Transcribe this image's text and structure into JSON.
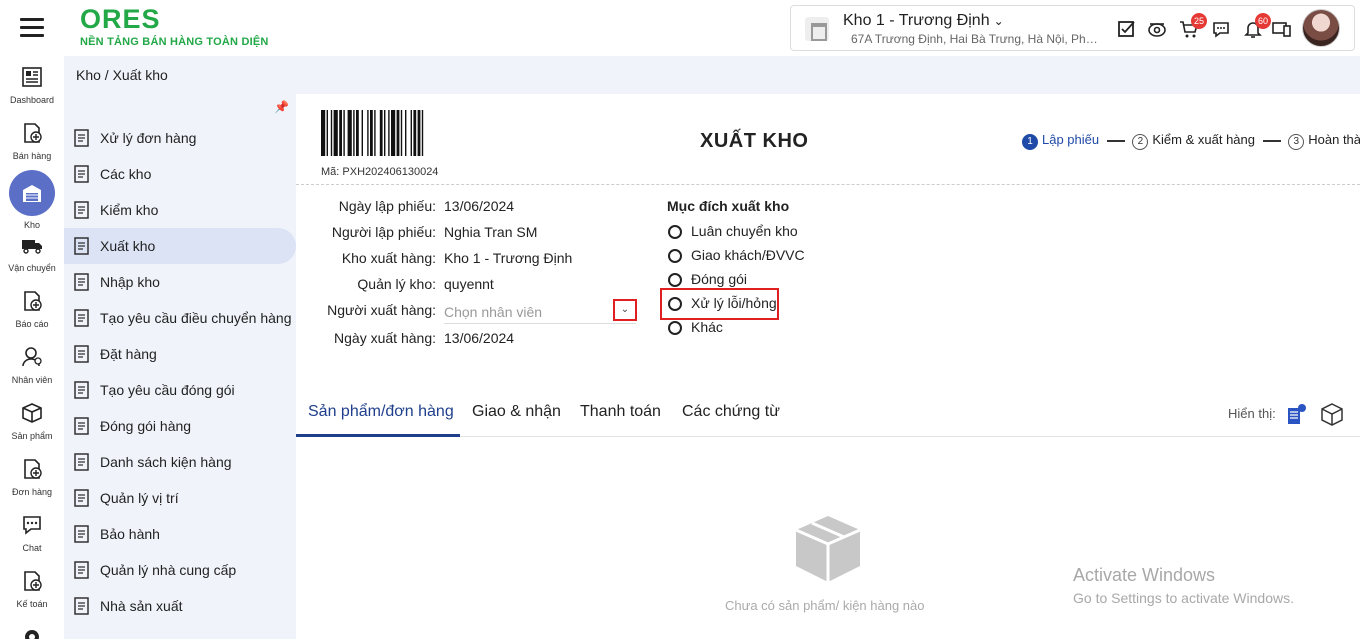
{
  "brand": {
    "name": "ORES",
    "tagline": "NỀN TẢNG BÁN HÀNG TOÀN DIỆN"
  },
  "store": {
    "name": "Kho 1 - Trương Định",
    "address": "67A Trương Định, Hai Bà Trưng, Hà Nội, Phường..."
  },
  "topbar": {
    "cart_badge": "25",
    "bell_badge": "60"
  },
  "rail": [
    {
      "label": "Dashboard",
      "icon": "dashboard-icon"
    },
    {
      "label": "Bán hàng",
      "icon": "sales-icon"
    },
    {
      "label": "Kho",
      "icon": "warehouse-icon"
    },
    {
      "label": "Vận chuyển",
      "icon": "truck-icon"
    },
    {
      "label": "Báo cáo",
      "icon": "report-icon"
    },
    {
      "label": "Nhân viên",
      "icon": "staff-icon"
    },
    {
      "label": "Sản phẩm",
      "icon": "product-icon"
    },
    {
      "label": "Đơn hàng",
      "icon": "order-icon"
    },
    {
      "label": "Chat",
      "icon": "chat-icon"
    },
    {
      "label": "Kế toán",
      "icon": "accounting-icon"
    }
  ],
  "breadcrumb": "Kho / Xuất kho",
  "sidebar": {
    "items": [
      {
        "label": "Xử lý đơn hàng",
        "icon": "order-process-icon"
      },
      {
        "label": "Các kho",
        "icon": "warehouses-icon"
      },
      {
        "label": "Kiểm kho",
        "icon": "stock-check-icon"
      },
      {
        "label": "Xuất kho",
        "icon": "export-icon",
        "active": true
      },
      {
        "label": "Nhập kho",
        "icon": "import-icon"
      },
      {
        "label": "Tạo yêu cầu điều chuyển hàng",
        "icon": "transfer-icon"
      },
      {
        "label": "Đặt hàng",
        "icon": "place-order-icon"
      },
      {
        "label": "Tạo yêu cầu đóng gói",
        "icon": "pack-request-icon"
      },
      {
        "label": "Đóng gói hàng",
        "icon": "package-icon"
      },
      {
        "label": "Danh sách kiện hàng",
        "icon": "checklist-icon"
      },
      {
        "label": "Quản lý vị trí",
        "icon": "location-icon"
      },
      {
        "label": "Bảo hành",
        "icon": "warranty-icon"
      },
      {
        "label": "Quản lý nhà cung cấp",
        "icon": "supplier-icon"
      },
      {
        "label": "Nhà sản xuất",
        "icon": "manufacturer-icon"
      }
    ]
  },
  "doc": {
    "code_label": "Mã: PXH202406130024",
    "title": "XUẤT KHO",
    "steps": [
      {
        "num": "1",
        "label": "Lập phiếu",
        "active": true
      },
      {
        "num": "2",
        "label": "Kiểm & xuất hàng",
        "active": false
      },
      {
        "num": "3",
        "label": "Hoàn thành",
        "active": false
      }
    ]
  },
  "form": {
    "created_date_label": "Ngày lập phiếu:",
    "created_date": "13/06/2024",
    "creator_label": "Người lập phiếu:",
    "creator": "Nghia Tran SM",
    "warehouse_label": "Kho xuất hàng:",
    "warehouse": "Kho 1 - Trương Định",
    "manager_label": "Quản lý kho:",
    "manager": "quyennt",
    "exporter_label": "Người xuất hàng:",
    "exporter_placeholder": "Chọn nhân viên",
    "export_date_label": "Ngày xuất hàng:",
    "export_date": "13/06/2024"
  },
  "purpose": {
    "title": "Mục đích xuất kho",
    "options": [
      "Luân chuyển kho",
      "Giao khách/ĐVVC",
      "Đóng gói",
      "Xử lý lỗi/hỏng",
      "Khác"
    ]
  },
  "tabs": {
    "items": [
      "Sản phẩm/đơn hàng",
      "Giao & nhận",
      "Thanh toán",
      "Các chứng từ"
    ],
    "show_label": "Hiển thị:"
  },
  "empty": {
    "text": "Chưa có sản phẩm/ kiện hàng nào"
  },
  "watermark": {
    "line1": "Activate Windows",
    "line2": "Go to Settings to activate Windows."
  },
  "colors": {
    "brand": "#22a847",
    "accent": "#1f3f8c",
    "highlight": "#e02020",
    "sidebar_bg": "#f0f3fa"
  }
}
